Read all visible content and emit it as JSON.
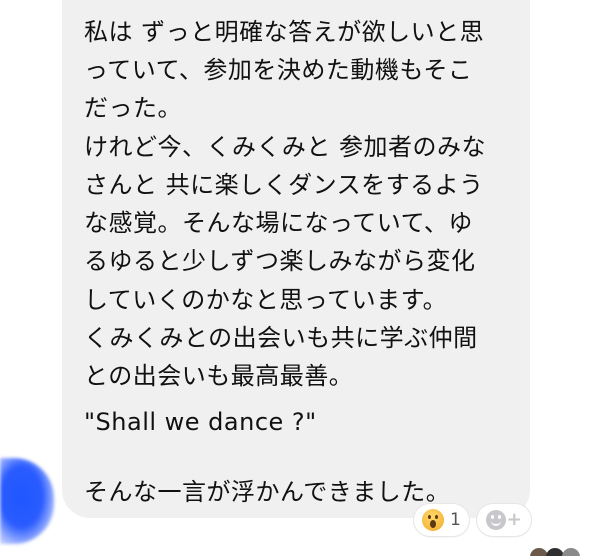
{
  "message": {
    "lines": [
      "私は ずっと明確な答えが欲しいと思",
      "っていて、参加を決めた動機もそこ",
      "だった。",
      "けれど今、くみくみと 参加者のみな",
      "さんと 共に楽しくダンスをするよう",
      "な感覚。そんな場になっていて、ゆ",
      "るゆると少しずつ楽しみながら変化",
      "していくのかなと思っています。",
      "くみくみとの出会いも共に学ぶ仲間",
      "との出会いも最高最善。",
      "",
      "\"Shall we dance ?\"",
      "",
      "そんな一言が浮かんできました。"
    ]
  },
  "reactions": {
    "emoji_name": "wow-emoji-icon",
    "count": "1",
    "add_icon_name": "add-reaction-icon",
    "add_symbol": "+"
  },
  "colors": {
    "bubble": "#f0f0f1",
    "text": "#111111",
    "avatar": "#2a5cff"
  }
}
